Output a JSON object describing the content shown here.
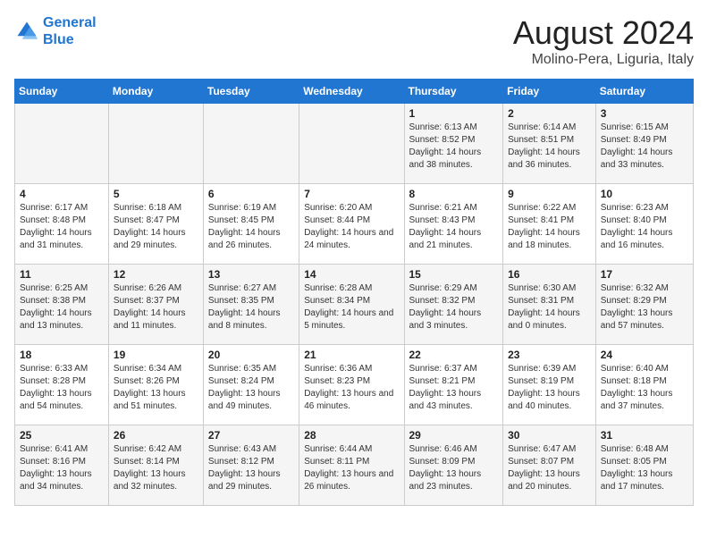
{
  "logo": {
    "line1": "General",
    "line2": "Blue"
  },
  "title": "August 2024",
  "subtitle": "Molino-Pera, Liguria, Italy",
  "days_of_week": [
    "Sunday",
    "Monday",
    "Tuesday",
    "Wednesday",
    "Thursday",
    "Friday",
    "Saturday"
  ],
  "weeks": [
    [
      {
        "day": "",
        "info": ""
      },
      {
        "day": "",
        "info": ""
      },
      {
        "day": "",
        "info": ""
      },
      {
        "day": "",
        "info": ""
      },
      {
        "day": "1",
        "info": "Sunrise: 6:13 AM\nSunset: 8:52 PM\nDaylight: 14 hours and 38 minutes."
      },
      {
        "day": "2",
        "info": "Sunrise: 6:14 AM\nSunset: 8:51 PM\nDaylight: 14 hours and 36 minutes."
      },
      {
        "day": "3",
        "info": "Sunrise: 6:15 AM\nSunset: 8:49 PM\nDaylight: 14 hours and 33 minutes."
      }
    ],
    [
      {
        "day": "4",
        "info": "Sunrise: 6:17 AM\nSunset: 8:48 PM\nDaylight: 14 hours and 31 minutes."
      },
      {
        "day": "5",
        "info": "Sunrise: 6:18 AM\nSunset: 8:47 PM\nDaylight: 14 hours and 29 minutes."
      },
      {
        "day": "6",
        "info": "Sunrise: 6:19 AM\nSunset: 8:45 PM\nDaylight: 14 hours and 26 minutes."
      },
      {
        "day": "7",
        "info": "Sunrise: 6:20 AM\nSunset: 8:44 PM\nDaylight: 14 hours and 24 minutes."
      },
      {
        "day": "8",
        "info": "Sunrise: 6:21 AM\nSunset: 8:43 PM\nDaylight: 14 hours and 21 minutes."
      },
      {
        "day": "9",
        "info": "Sunrise: 6:22 AM\nSunset: 8:41 PM\nDaylight: 14 hours and 18 minutes."
      },
      {
        "day": "10",
        "info": "Sunrise: 6:23 AM\nSunset: 8:40 PM\nDaylight: 14 hours and 16 minutes."
      }
    ],
    [
      {
        "day": "11",
        "info": "Sunrise: 6:25 AM\nSunset: 8:38 PM\nDaylight: 14 hours and 13 minutes."
      },
      {
        "day": "12",
        "info": "Sunrise: 6:26 AM\nSunset: 8:37 PM\nDaylight: 14 hours and 11 minutes."
      },
      {
        "day": "13",
        "info": "Sunrise: 6:27 AM\nSunset: 8:35 PM\nDaylight: 14 hours and 8 minutes."
      },
      {
        "day": "14",
        "info": "Sunrise: 6:28 AM\nSunset: 8:34 PM\nDaylight: 14 hours and 5 minutes."
      },
      {
        "day": "15",
        "info": "Sunrise: 6:29 AM\nSunset: 8:32 PM\nDaylight: 14 hours and 3 minutes."
      },
      {
        "day": "16",
        "info": "Sunrise: 6:30 AM\nSunset: 8:31 PM\nDaylight: 14 hours and 0 minutes."
      },
      {
        "day": "17",
        "info": "Sunrise: 6:32 AM\nSunset: 8:29 PM\nDaylight: 13 hours and 57 minutes."
      }
    ],
    [
      {
        "day": "18",
        "info": "Sunrise: 6:33 AM\nSunset: 8:28 PM\nDaylight: 13 hours and 54 minutes."
      },
      {
        "day": "19",
        "info": "Sunrise: 6:34 AM\nSunset: 8:26 PM\nDaylight: 13 hours and 51 minutes."
      },
      {
        "day": "20",
        "info": "Sunrise: 6:35 AM\nSunset: 8:24 PM\nDaylight: 13 hours and 49 minutes."
      },
      {
        "day": "21",
        "info": "Sunrise: 6:36 AM\nSunset: 8:23 PM\nDaylight: 13 hours and 46 minutes."
      },
      {
        "day": "22",
        "info": "Sunrise: 6:37 AM\nSunset: 8:21 PM\nDaylight: 13 hours and 43 minutes."
      },
      {
        "day": "23",
        "info": "Sunrise: 6:39 AM\nSunset: 8:19 PM\nDaylight: 13 hours and 40 minutes."
      },
      {
        "day": "24",
        "info": "Sunrise: 6:40 AM\nSunset: 8:18 PM\nDaylight: 13 hours and 37 minutes."
      }
    ],
    [
      {
        "day": "25",
        "info": "Sunrise: 6:41 AM\nSunset: 8:16 PM\nDaylight: 13 hours and 34 minutes."
      },
      {
        "day": "26",
        "info": "Sunrise: 6:42 AM\nSunset: 8:14 PM\nDaylight: 13 hours and 32 minutes."
      },
      {
        "day": "27",
        "info": "Sunrise: 6:43 AM\nSunset: 8:12 PM\nDaylight: 13 hours and 29 minutes."
      },
      {
        "day": "28",
        "info": "Sunrise: 6:44 AM\nSunset: 8:11 PM\nDaylight: 13 hours and 26 minutes."
      },
      {
        "day": "29",
        "info": "Sunrise: 6:46 AM\nSunset: 8:09 PM\nDaylight: 13 hours and 23 minutes."
      },
      {
        "day": "30",
        "info": "Sunrise: 6:47 AM\nSunset: 8:07 PM\nDaylight: 13 hours and 20 minutes."
      },
      {
        "day": "31",
        "info": "Sunrise: 6:48 AM\nSunset: 8:05 PM\nDaylight: 13 hours and 17 minutes."
      }
    ]
  ]
}
